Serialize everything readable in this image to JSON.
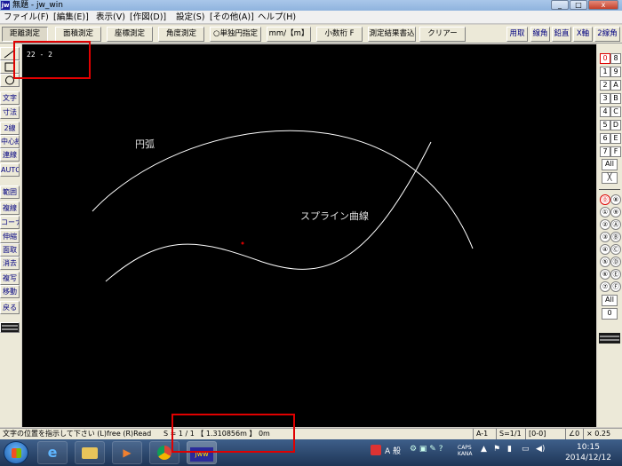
{
  "window": {
    "title": "無題 - jw_win",
    "app_icon": "jw"
  },
  "window_buttons": [
    "_",
    "□",
    "x"
  ],
  "menu": [
    "ファイル(F)",
    "[編集(E)]",
    "表示(V)",
    "[作図(D)]",
    "設定(S)",
    "[その他(A)]",
    "ヘルプ(H)"
  ],
  "toolbar": {
    "buttons": [
      "距離測定",
      "面積測定",
      "座標測定",
      "角度測定",
      "○単独円指定",
      "mm/【m】",
      "小数桁 F",
      "測定結果書込",
      "クリアー"
    ],
    "right_buttons": [
      "用取",
      "線角",
      "鉛直",
      "X軸",
      "2線角"
    ]
  },
  "left_tools": {
    "top_icons": [
      "line-icon",
      "rect-icon",
      "circle-icon"
    ],
    "labels": [
      "文字",
      "寸法",
      "2線",
      "中心線",
      "連線",
      "AUTO",
      "範囲",
      "複線",
      "コーナー",
      "伸縮",
      "面取",
      "消去",
      "複写",
      "移動",
      "戻る"
    ]
  },
  "canvas": {
    "coord_readout": "22 - 2",
    "labels": {
      "arc": "円弧",
      "spline": "スプライン曲線"
    }
  },
  "right_layers": {
    "groups": [
      "0",
      "8",
      "1",
      "9",
      "2",
      "A",
      "3",
      "B",
      "4",
      "C",
      "5",
      "D",
      "6",
      "E",
      "7",
      "F"
    ],
    "all_label": "All",
    "x_label": "╳",
    "circled": [
      "⓪",
      "⑧",
      "①",
      "⑨",
      "②",
      "Ⓐ",
      "③",
      "Ⓑ",
      "④",
      "Ⓒ",
      "⑤",
      "Ⓓ",
      "⑥",
      "Ⓔ",
      "⑦",
      "Ⓕ"
    ],
    "all_label2": "All",
    "zero_label": "0"
  },
  "statusbar": {
    "message": "文字の位置を指示して下さい (L)free (R)Read",
    "scale": "S = 1 / 1 【 1.310856m 】 0m",
    "paper": "A-1",
    "scale2": "S=1/1",
    "layer": "[0-0]",
    "angle": "∠0",
    "zoom": "× 0.25"
  },
  "taskbar": {
    "tray_lang": "A 般",
    "tray_caps": "CAPS KANA",
    "time": "10:15",
    "date": "2014/12/12"
  },
  "colors": {
    "canvas_bg": "#000000",
    "curve": "#ffffff",
    "highlight": "#e00000",
    "cursor_point": "#d00000"
  }
}
